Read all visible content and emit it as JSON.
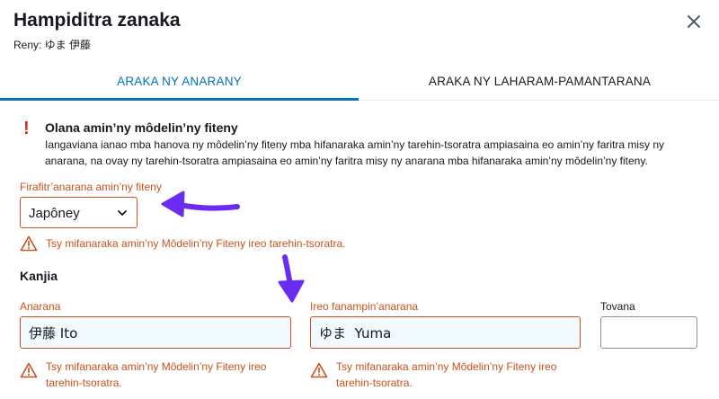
{
  "dialog": {
    "title": "Hampiditra zanaka",
    "subtitle": "Reny: ゆま 伊藤"
  },
  "tabs": [
    {
      "label": "ARAKA NY ANARANY",
      "active": true
    },
    {
      "label": "ARAKA NY LAHARAM-PAMANTARANA",
      "active": false
    }
  ],
  "warning": {
    "icon": "exclamation-icon",
    "title": "Olana amin’ny môdelin’ny fiteny",
    "body": "Iangaviana ianao mba hanova ny môdelin’ny fiteny mba hifanaraka amin’ny tarehin-tsoratra ampiasaina eo amin’ny faritra misy ny anarana, na ovay ny tarehin-tsoratra ampiasaina eo amin’ny faritra misy ny anarana mba hifanaraka amin’ny môdelin’ny fiteny."
  },
  "language_select": {
    "label": "Firafitr’anarana amin’ny fiteny",
    "value": "Japôney",
    "error": "Tsy mifanaraka amin’ny Môdelin’ny Fiteny ireo tarehin-tsoratra."
  },
  "section": {
    "title": "Kanjia"
  },
  "fields": {
    "surname": {
      "label": "Anarana",
      "value": "伊藤 Ito",
      "error": "Tsy mifanaraka amin’ny Môdelin’ny Fiteny ireo tarehin-tsoratra."
    },
    "given_name": {
      "label": "Ireo fanampin’anarana",
      "value": "ゆま  Yuma",
      "error": "Tsy mifanaraka amin’ny Môdelin’ny Fiteny ireo tarehin-tsoratra."
    },
    "suffix": {
      "label": "Tovana",
      "value": ""
    }
  },
  "colors": {
    "accent": "#0073bb",
    "error": "#c7511f",
    "warning_icon": "#d13212",
    "annotation_arrow": "#6a2cf0",
    "input_fill": "#f1faff"
  }
}
